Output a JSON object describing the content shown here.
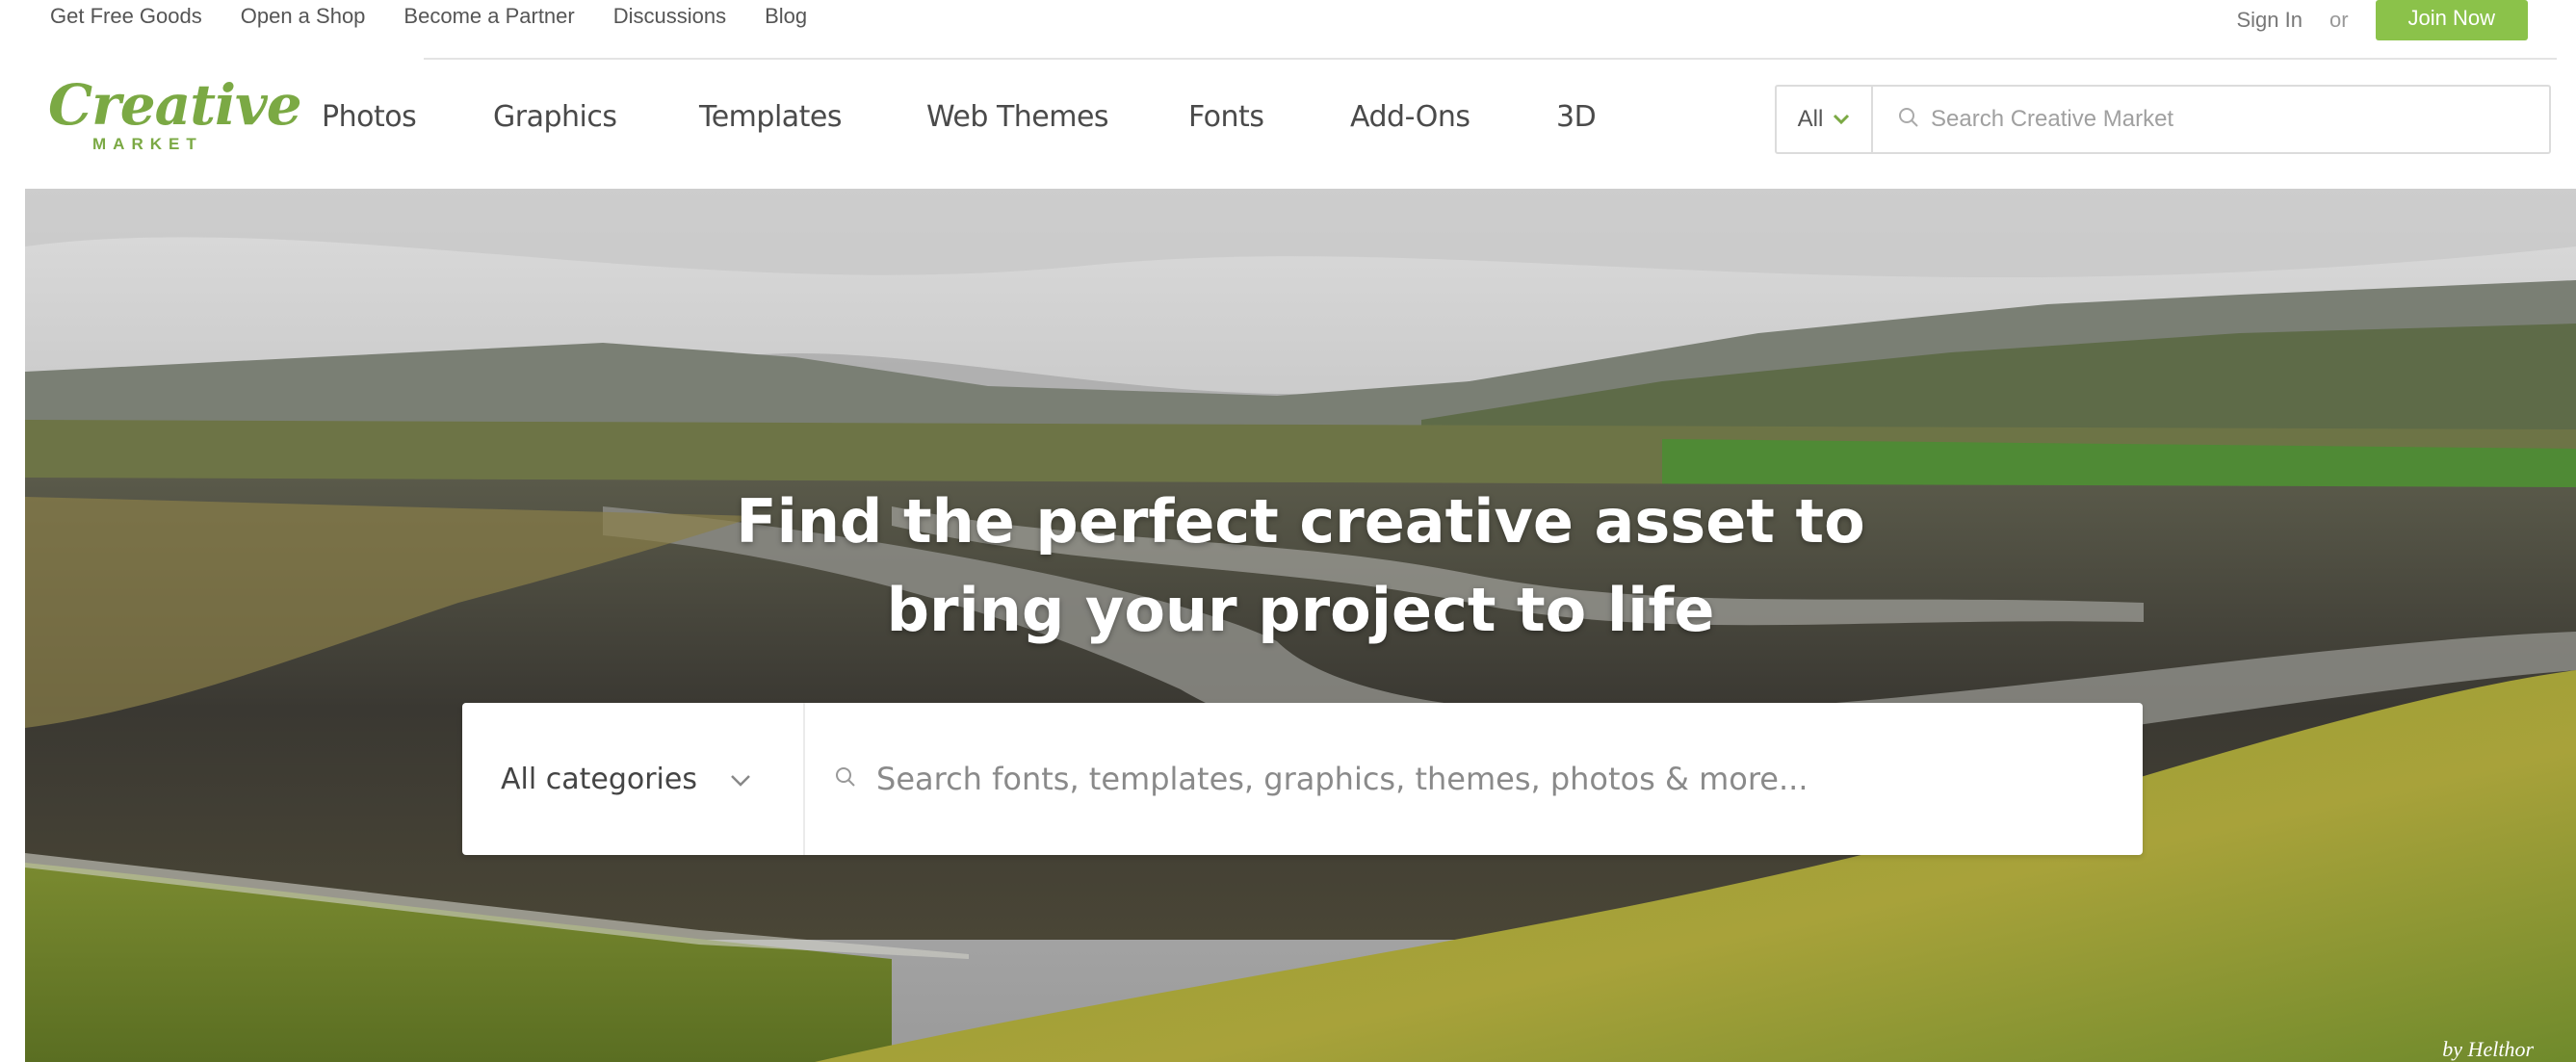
{
  "topbar": {
    "links": [
      "Get Free Goods",
      "Open a Shop",
      "Become a Partner",
      "Discussions",
      "Blog"
    ],
    "sign_in": "Sign In",
    "or": "or",
    "join": "Join Now"
  },
  "logo": {
    "word": "Creative",
    "sub": "MARKET"
  },
  "nav": {
    "items": [
      "Photos",
      "Graphics",
      "Templates",
      "Web Themes",
      "Fonts",
      "Add-Ons",
      "3D"
    ]
  },
  "nav_search": {
    "scope": "All",
    "placeholder": "Search Creative Market"
  },
  "hero": {
    "headline_line1": "Find the perfect creative asset to",
    "headline_line2": "bring your project to life",
    "category_label": "All categories",
    "search_placeholder": "Search fonts, templates, graphics, themes, photos & more...",
    "credit": "by Helthor"
  },
  "colors": {
    "brand_green": "#7ba944",
    "join_button": "#8bc24a"
  },
  "icons": {
    "search": "search-icon",
    "chevron": "chevron-down-icon"
  }
}
